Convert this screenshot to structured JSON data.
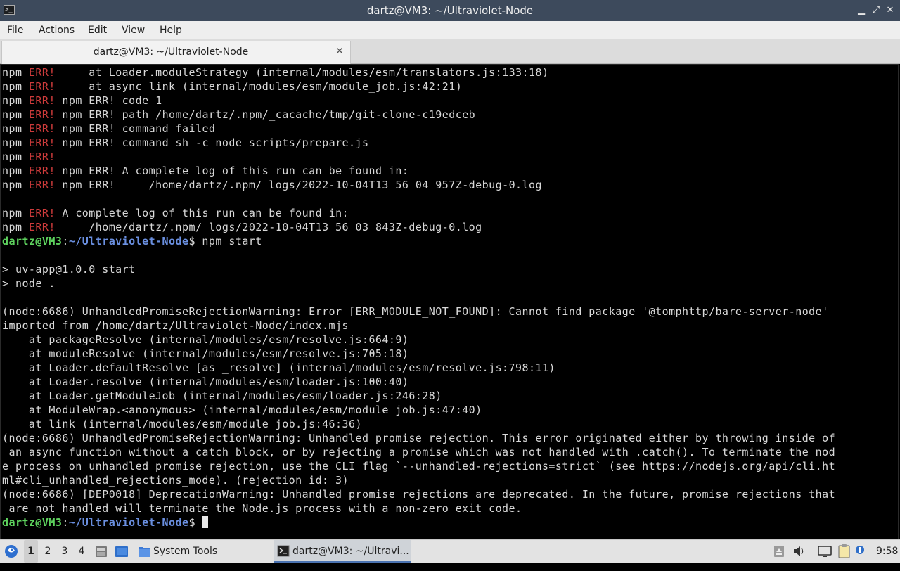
{
  "window": {
    "title": "dartz@VM3: ~/Ultraviolet-Node",
    "app_icon": "terminal-icon",
    "controls": [
      "minimize-icon",
      "maximize-icon",
      "close-icon"
    ]
  },
  "menu": {
    "items": [
      "File",
      "Actions",
      "Edit",
      "View",
      "Help"
    ]
  },
  "tab": {
    "title": "dartz@VM3: ~/Ultraviolet-Node",
    "close_glyph": "✕"
  },
  "terminal": {
    "prompt": {
      "user_host": "dartz@VM3",
      "sep": ":",
      "path": "~/Ultraviolet-Node",
      "symbol": "$"
    },
    "lines": [
      [
        {
          "t": "npm "
        },
        {
          "t": "ERR!",
          "c": "err"
        },
        {
          "t": "     at Loader.moduleStrategy (internal/modules/esm/translators.js:133:18)"
        }
      ],
      [
        {
          "t": "npm "
        },
        {
          "t": "ERR!",
          "c": "err"
        },
        {
          "t": "     at async link (internal/modules/esm/module_job.js:42:21)"
        }
      ],
      [
        {
          "t": "npm "
        },
        {
          "t": "ERR!",
          "c": "err"
        },
        {
          "t": " npm ERR! code 1"
        }
      ],
      [
        {
          "t": "npm "
        },
        {
          "t": "ERR!",
          "c": "err"
        },
        {
          "t": " npm ERR! path /home/dartz/.npm/_cacache/tmp/git-clone-c19edceb"
        }
      ],
      [
        {
          "t": "npm "
        },
        {
          "t": "ERR!",
          "c": "err"
        },
        {
          "t": " npm ERR! command failed"
        }
      ],
      [
        {
          "t": "npm "
        },
        {
          "t": "ERR!",
          "c": "err"
        },
        {
          "t": " npm ERR! command sh -c node scripts/prepare.js"
        }
      ],
      [
        {
          "t": "npm "
        },
        {
          "t": "ERR!",
          "c": "err"
        }
      ],
      [
        {
          "t": "npm "
        },
        {
          "t": "ERR!",
          "c": "err"
        },
        {
          "t": " npm ERR! A complete log of this run can be found in:"
        }
      ],
      [
        {
          "t": "npm "
        },
        {
          "t": "ERR!",
          "c": "err"
        },
        {
          "t": " npm ERR!     /home/dartz/.npm/_logs/2022-10-04T13_56_04_957Z-debug-0.log"
        }
      ],
      [],
      [
        {
          "t": "npm "
        },
        {
          "t": "ERR!",
          "c": "err"
        },
        {
          "t": " A complete log of this run can be found in:"
        }
      ],
      [
        {
          "t": "npm "
        },
        {
          "t": "ERR!",
          "c": "err"
        },
        {
          "t": "     /home/dartz/.npm/_logs/2022-10-04T13_56_03_843Z-debug-0.log"
        }
      ],
      [
        {
          "t": "dartz@VM3",
          "c": "pu"
        },
        {
          "t": ":"
        },
        {
          "t": "~/Ultraviolet-Node",
          "c": "pp"
        },
        {
          "t": "$ npm start"
        }
      ],
      [],
      [
        {
          "t": "> uv-app@1.0.0 start"
        }
      ],
      [
        {
          "t": "> node ."
        }
      ],
      [],
      [
        {
          "t": "(node:6686) UnhandledPromiseRejectionWarning: Error [ERR_MODULE_NOT_FOUND]: Cannot find package '@tomphttp/bare-server-node'"
        }
      ],
      [
        {
          "t": "imported from /home/dartz/Ultraviolet-Node/index.mjs"
        }
      ],
      [
        {
          "t": "    at packageResolve (internal/modules/esm/resolve.js:664:9)"
        }
      ],
      [
        {
          "t": "    at moduleResolve (internal/modules/esm/resolve.js:705:18)"
        }
      ],
      [
        {
          "t": "    at Loader.defaultResolve [as _resolve] (internal/modules/esm/resolve.js:798:11)"
        }
      ],
      [
        {
          "t": "    at Loader.resolve (internal/modules/esm/loader.js:100:40)"
        }
      ],
      [
        {
          "t": "    at Loader.getModuleJob (internal/modules/esm/loader.js:246:28)"
        }
      ],
      [
        {
          "t": "    at ModuleWrap.<anonymous> (internal/modules/esm/module_job.js:47:40)"
        }
      ],
      [
        {
          "t": "    at link (internal/modules/esm/module_job.js:46:36)"
        }
      ],
      [
        {
          "t": "(node:6686) UnhandledPromiseRejectionWarning: Unhandled promise rejection. This error originated either by throwing inside of"
        }
      ],
      [
        {
          "t": " an async function without a catch block, or by rejecting a promise which was not handled with .catch(). To terminate the nod"
        }
      ],
      [
        {
          "t": "e process on unhandled promise rejection, use the CLI flag `--unhandled-rejections=strict` (see https://nodejs.org/api/cli.ht"
        }
      ],
      [
        {
          "t": "ml#cli_unhandled_rejections_mode). (rejection id: 3)"
        }
      ],
      [
        {
          "t": "(node:6686) [DEP0018] DeprecationWarning: Unhandled promise rejections are deprecated. In the future, promise rejections that"
        }
      ],
      [
        {
          "t": " are not handled will terminate the Node.js process with a non-zero exit code."
        }
      ],
      [
        {
          "t": "dartz@VM3",
          "c": "pu"
        },
        {
          "t": ":"
        },
        {
          "t": "~/Ultraviolet-Node",
          "c": "pp"
        },
        {
          "t": "$ "
        },
        {
          "cursor": true
        }
      ]
    ]
  },
  "taskbar": {
    "start_icon": "start-menu-icon",
    "workspaces": [
      "1",
      "2",
      "3",
      "4"
    ],
    "active_workspace": "1",
    "quicklaunch": [
      "file-manager-icon",
      "show-desktop-icon"
    ],
    "tasks": [
      {
        "icon": "folder-icon",
        "label": "System Tools"
      },
      {
        "icon": "terminal-icon",
        "label": "dartz@VM3: ~/Ultravi..."
      }
    ],
    "tray": [
      "eject-icon",
      "volume-icon",
      "display-icon",
      "clipboard-icon",
      "update-notifier-icon"
    ],
    "clock": "9:58"
  }
}
